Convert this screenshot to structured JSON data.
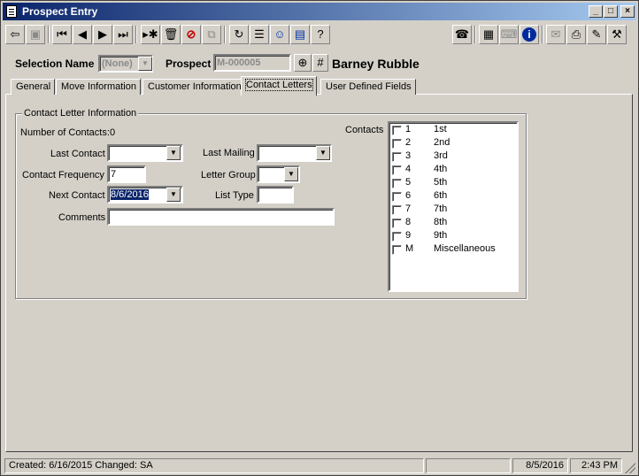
{
  "window": {
    "title": "Prospect Entry",
    "controls": {
      "minimize": "_",
      "maximize": "□",
      "close": "×"
    }
  },
  "toolbar": {
    "left_icons": [
      "exit-icon",
      "save-icon",
      "first-record-icon",
      "prev-record-icon",
      "next-record-icon",
      "last-record-icon",
      "new-record-icon",
      "delete-icon",
      "cancel-icon",
      "copy-icon",
      "refresh-icon",
      "notes-icon",
      "contacts-icon",
      "clipboard-icon",
      "help-icon"
    ],
    "right_icons": [
      "phone-icon",
      "calculator-icon",
      "keyboard-icon",
      "info-icon",
      "mail-icon",
      "printer-icon",
      "note-icon",
      "tools-icon"
    ]
  },
  "header": {
    "selection_name_label": "Selection Name",
    "selection_name_value": "(None)",
    "prospect_label": "Prospect",
    "prospect_id": "M-000005",
    "prospect_name": "Barney Rubble"
  },
  "tabs": [
    {
      "label": "General",
      "active": false
    },
    {
      "label": "Move Information",
      "active": false
    },
    {
      "label": "Customer Information",
      "active": false
    },
    {
      "label": "Contact Letters",
      "active": true
    },
    {
      "label": "User Defined Fields",
      "active": false
    }
  ],
  "contact_letters": {
    "group_title": "Contact Letter Information",
    "number_of_contacts_label": "Number of Contacts:",
    "number_of_contacts_value": "0",
    "last_contact_label": "Last Contact",
    "last_contact_value": "",
    "last_mailing_label": "Last Mailing",
    "last_mailing_value": "",
    "contact_frequency_label": "Contact Frequency",
    "contact_frequency_value": "7",
    "letter_group_label": "Letter Group",
    "letter_group_value": "",
    "next_contact_label": "Next Contact",
    "next_contact_value": "8/6/2016",
    "list_type_label": "List Type",
    "list_type_value": "",
    "comments_label": "Comments",
    "comments_value": "",
    "contacts_label": "Contacts",
    "contacts": [
      {
        "code": "1",
        "name": "1st",
        "checked": false
      },
      {
        "code": "2",
        "name": "2nd",
        "checked": false
      },
      {
        "code": "3",
        "name": "3rd",
        "checked": false
      },
      {
        "code": "4",
        "name": "4th",
        "checked": false
      },
      {
        "code": "5",
        "name": "5th",
        "checked": false
      },
      {
        "code": "6",
        "name": "6th",
        "checked": false
      },
      {
        "code": "7",
        "name": "7th",
        "checked": false
      },
      {
        "code": "8",
        "name": "8th",
        "checked": false
      },
      {
        "code": "9",
        "name": "9th",
        "checked": false
      },
      {
        "code": "M",
        "name": "Miscellaneous",
        "checked": false
      }
    ]
  },
  "status": {
    "created_changed": "Created: 6/16/2015   Changed: SA",
    "date": "8/5/2016",
    "time": "2:43 PM"
  }
}
